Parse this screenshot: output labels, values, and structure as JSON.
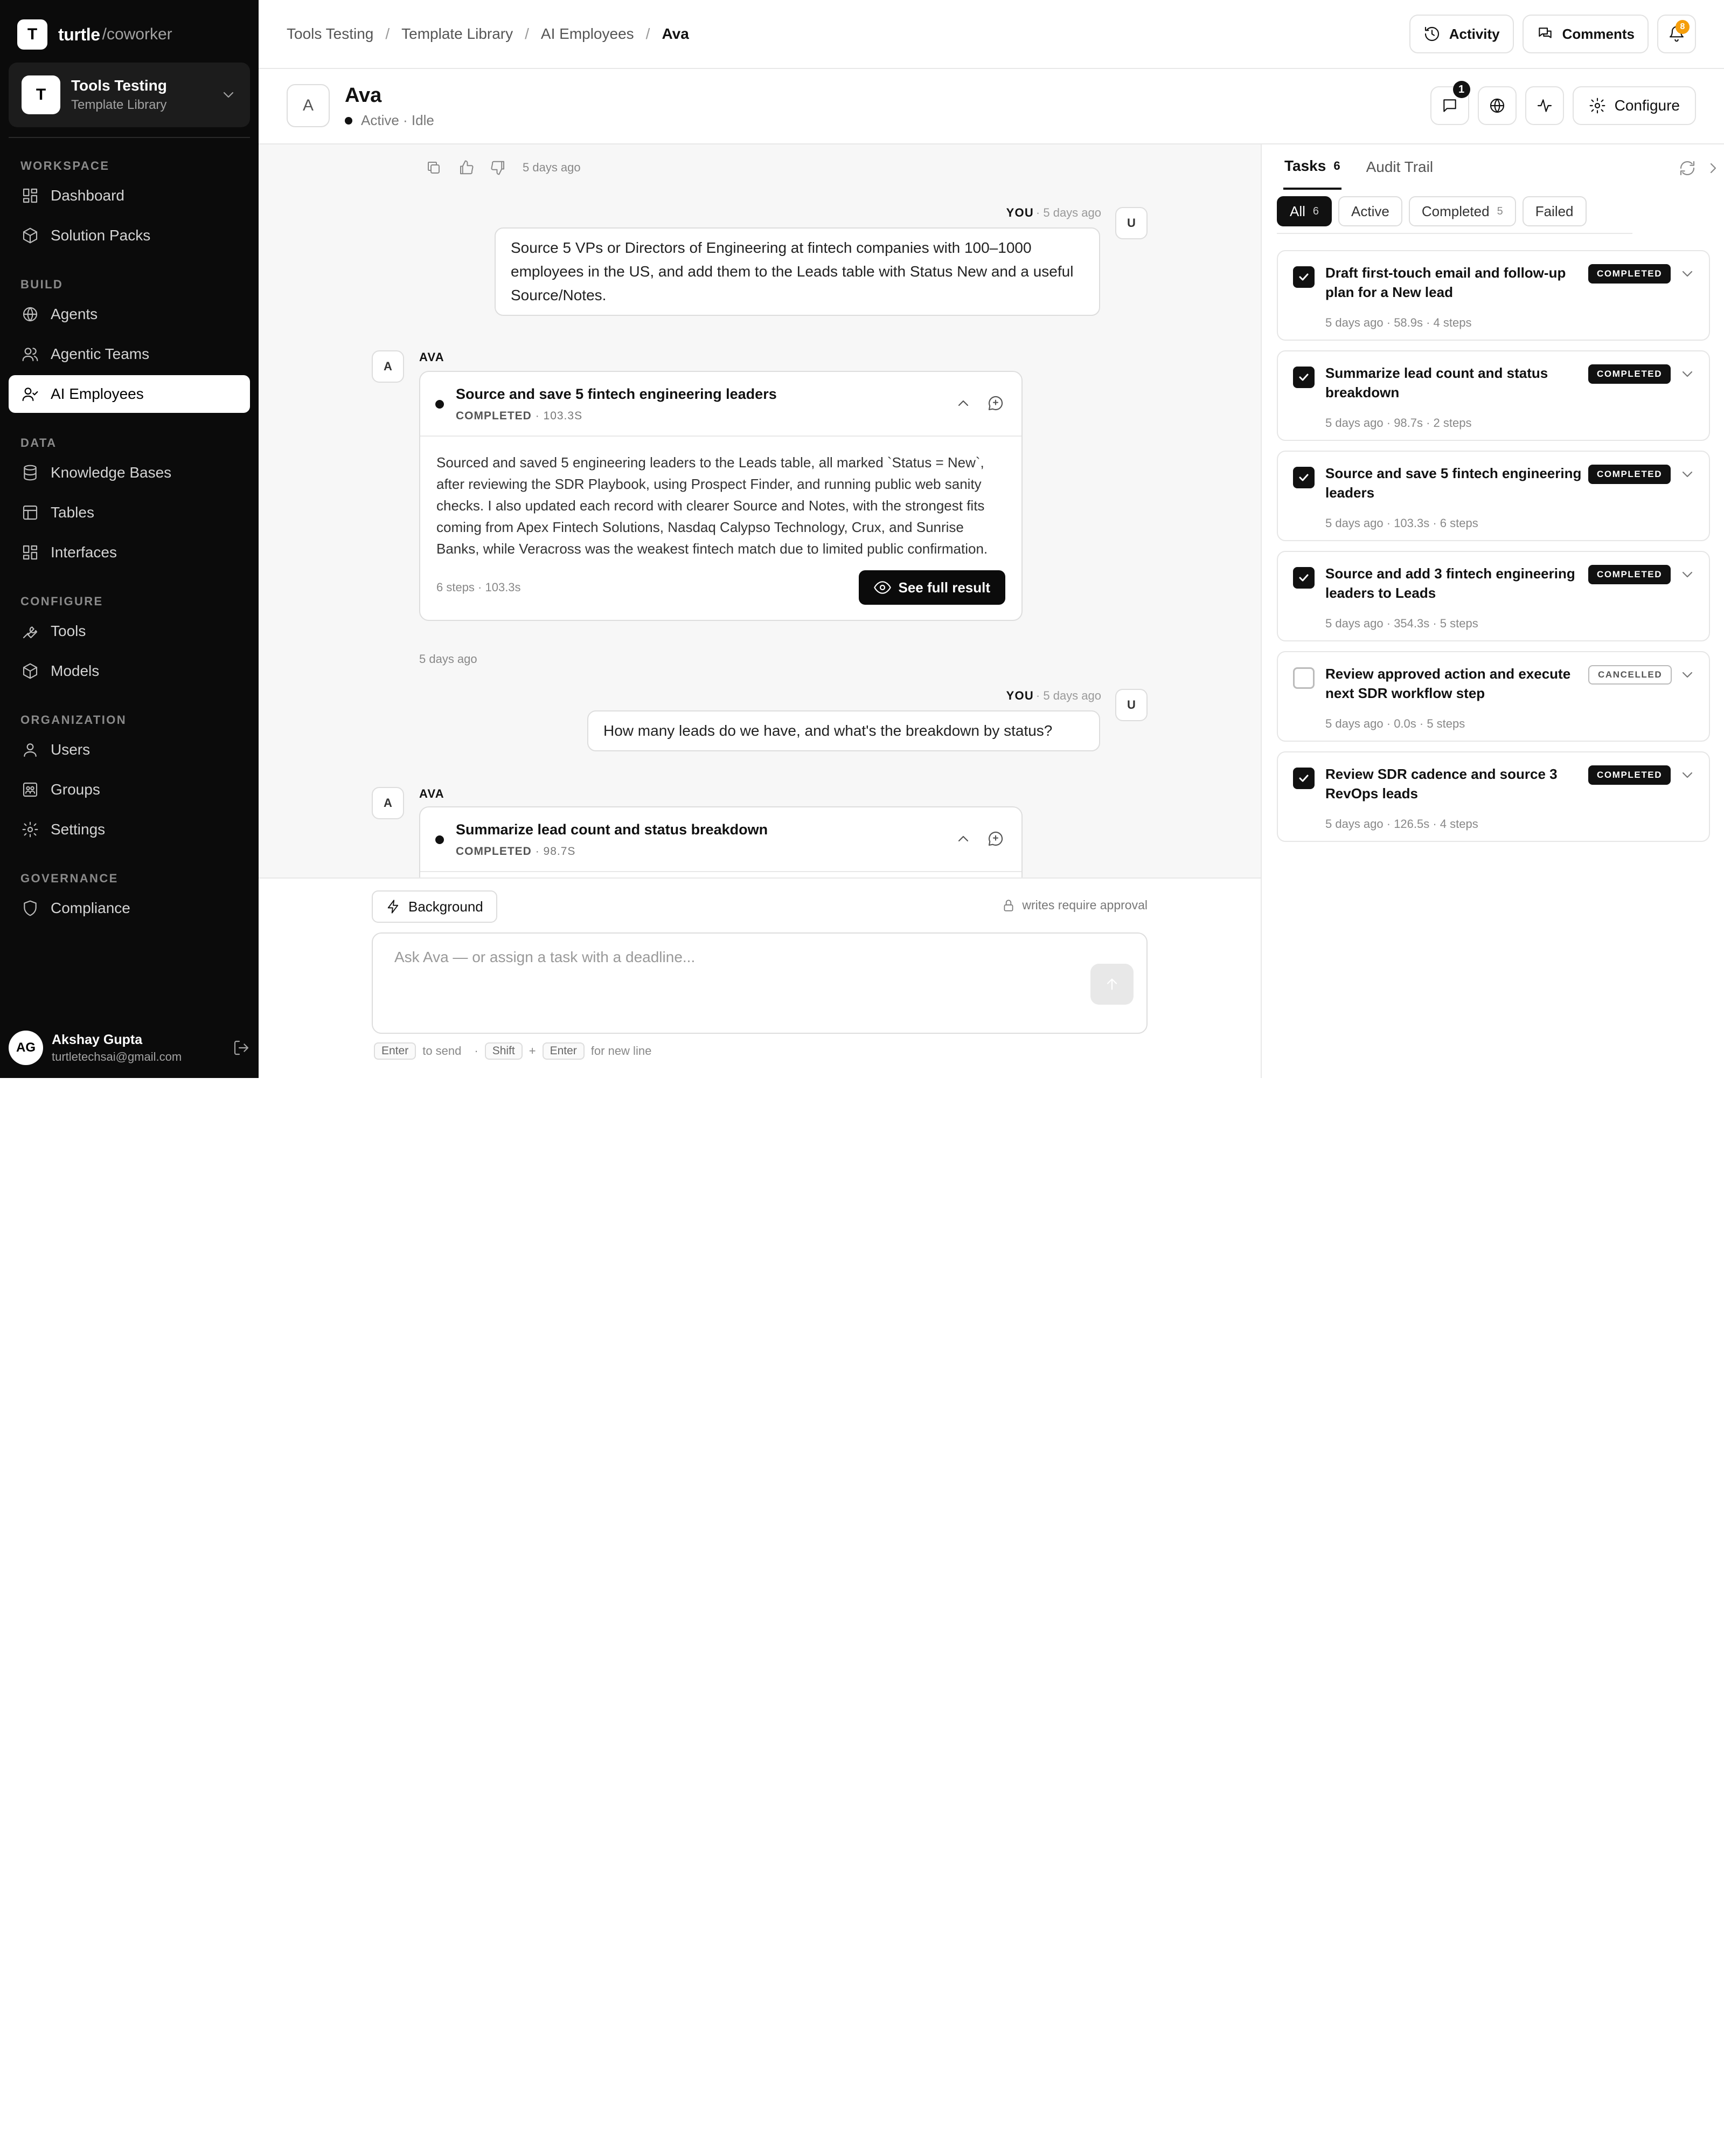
{
  "sidebar": {
    "brand": {
      "logo": "T",
      "name": "turtle",
      "suffix": "/coworker"
    },
    "workspace": {
      "logo": "T",
      "name": "Tools Testing",
      "subtitle": "Template Library"
    },
    "sections": [
      {
        "label": "WORKSPACE",
        "items": [
          {
            "label": "Dashboard",
            "icon": "grid-icon"
          },
          {
            "label": "Solution Packs",
            "icon": "package-icon"
          }
        ]
      },
      {
        "label": "BUILD",
        "items": [
          {
            "label": "Agents",
            "icon": "globe-icon"
          },
          {
            "label": "Agentic Teams",
            "icon": "users-icon"
          },
          {
            "label": "AI Employees",
            "icon": "user-check-icon",
            "active": true
          }
        ]
      },
      {
        "label": "DATA",
        "items": [
          {
            "label": "Knowledge Bases",
            "icon": "database-icon"
          },
          {
            "label": "Tables",
            "icon": "table-icon"
          },
          {
            "label": "Interfaces",
            "icon": "layout-icon"
          }
        ]
      },
      {
        "label": "CONFIGURE",
        "items": [
          {
            "label": "Tools",
            "icon": "wrench-icon"
          },
          {
            "label": "Models",
            "icon": "box-icon"
          }
        ]
      },
      {
        "label": "ORGANIZATION",
        "items": [
          {
            "label": "Users",
            "icon": "user-icon"
          },
          {
            "label": "Groups",
            "icon": "group-icon"
          },
          {
            "label": "Settings",
            "icon": "gear-icon"
          }
        ]
      },
      {
        "label": "GOVERNANCE",
        "items": [
          {
            "label": "Compliance",
            "icon": "shield-icon"
          }
        ]
      }
    ],
    "user": {
      "initials": "AG",
      "name": "Akshay Gupta",
      "email": "turtletechsai@gmail.com"
    }
  },
  "topbar": {
    "breadcrumb": [
      "Tools Testing",
      "Template Library",
      "AI Employees",
      "Ava"
    ],
    "activity_label": "Activity",
    "comments_label": "Comments",
    "notification_count": "8"
  },
  "agent": {
    "avatar": "A",
    "name": "Ava",
    "status": "Active · Idle",
    "comment_count": "1",
    "configure_label": "Configure"
  },
  "chat": {
    "top_actions_time": "5 days ago",
    "messages": [
      {
        "role": "YOU",
        "time": "· 5 days ago",
        "avatar": "U",
        "text": "Source 5 VPs or Directors of Engineering at fintech companies with 100–1000 employees in the US, and add them to the Leads table with Status New and a useful Source/Notes."
      },
      {
        "role": "AVA",
        "avatar": "A",
        "card": {
          "title": "Source and save 5 fintech engineering leaders",
          "status": "COMPLETED",
          "duration": "· 103.3S",
          "body": "Sourced and saved 5 engineering leaders to the Leads table, all marked `Status = New`, after reviewing the SDR Playbook, using Prospect Finder, and running public web sanity checks. I also updated each record with clearer Source and Notes, with the strongest fits coming from Apex Fintech Solutions, Nasdaq Calypso Technology, Crux, and Sunrise Banks, while Veracross was the weakest fintech match due to limited public confirmation.",
          "footer_meta": "6 steps · 103.3s",
          "button_label": "See full result"
        },
        "time": "5 days ago"
      },
      {
        "role": "YOU",
        "time": "· 5 days ago",
        "avatar": "U",
        "text": "How many leads do we have, and what's the breakdown by status?"
      },
      {
        "role": "AVA",
        "avatar": "A",
        "card": {
          "title": "Summarize lead count and status breakdown",
          "status": "COMPLETED",
          "duration": "· 98.7S"
        }
      }
    ]
  },
  "composer": {
    "background_label": "Background",
    "approval_note": "writes require approval",
    "placeholder": "Ask Ava — or assign a task with a deadline...",
    "hints": {
      "enter": "Enter",
      "to_send": "to send",
      "dot": "·",
      "shift": "Shift",
      "plus": "+",
      "enter2": "Enter",
      "new_line": "for new line"
    }
  },
  "panel": {
    "tabs": [
      {
        "label": "Tasks",
        "count": "6"
      },
      {
        "label": "Audit Trail"
      }
    ],
    "filters": [
      {
        "label": "All",
        "count": "6"
      },
      {
        "label": "Active"
      },
      {
        "label": "Completed",
        "count": "5"
      },
      {
        "label": "Failed"
      }
    ],
    "tasks": [
      {
        "title": "Draft first-touch email and follow-up plan for a New lead",
        "meta": "5 days ago · 58.9s · 4 steps",
        "status": "COMPLETED",
        "checked": true
      },
      {
        "title": "Summarize lead count and status breakdown",
        "meta": "5 days ago · 98.7s · 2 steps",
        "status": "COMPLETED",
        "checked": true
      },
      {
        "title": "Source and save 5 fintech engineering leaders",
        "meta": "5 days ago · 103.3s · 6 steps",
        "status": "COMPLETED",
        "checked": true
      },
      {
        "title": "Source and add 3 fintech engineering leaders to Leads",
        "meta": "5 days ago · 354.3s · 5 steps",
        "status": "COMPLETED",
        "checked": true
      },
      {
        "title": "Review approved action and execute next SDR workflow step",
        "meta": "5 days ago · 0.0s · 5 steps",
        "status": "CANCELLED",
        "checked": false
      },
      {
        "title": "Review SDR cadence and source 3 RevOps leads",
        "meta": "5 days ago · 126.5s · 4 steps",
        "status": "COMPLETED",
        "checked": true
      }
    ]
  }
}
